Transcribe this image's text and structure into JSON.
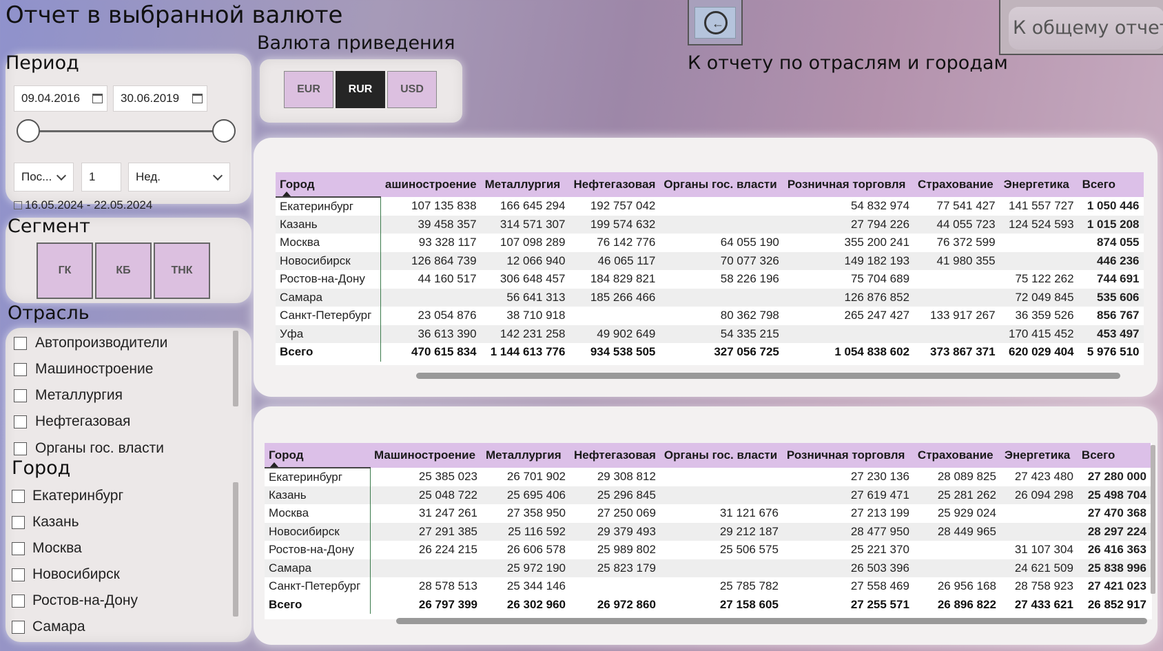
{
  "page": {
    "title": "Отчет в выбранной валюте"
  },
  "period": {
    "label": "Период",
    "start_date": "09.04.2016",
    "end_date": "30.06.2019",
    "relative_mode": "Пос...",
    "relative_count": "1",
    "relative_unit": "Нед.",
    "relative_range": "16.05.2024 - 22.05.2024"
  },
  "currency": {
    "label": "Валюта приведения",
    "options": [
      "EUR",
      "RUR",
      "USD"
    ],
    "selected": "RUR"
  },
  "segment": {
    "label": "Сегмент",
    "options": [
      "ГК",
      "КБ",
      "ТНК"
    ]
  },
  "industry_filter": {
    "label": "Отрасль",
    "items": [
      "Автопроизводители",
      "Машиностроение",
      "Металлургия",
      "Нефтегазовая",
      "Органы гос. власти"
    ]
  },
  "city_filter": {
    "label": "Город",
    "items": [
      "Екатеринбург",
      "Казань",
      "Москва",
      "Новосибирск",
      "Ростов-на-Дону",
      "Самара"
    ]
  },
  "nav": {
    "back_label": "К отчету по отраслям и городам",
    "main_report_label": "К общему отчету"
  },
  "table1": {
    "headers": [
      "Город",
      "ашиностроение",
      "Металлургия",
      "Нефтегазовая",
      "Органы гос. власти",
      "Розничная торговля",
      "Страхование",
      "Энергетика",
      "Всего"
    ],
    "rows": [
      [
        "Екатеринбург",
        "107 135 838",
        "166 645 294",
        "192 757 042",
        "",
        "54 832 974",
        "77 541 427",
        "141 557 727",
        "1 050 446"
      ],
      [
        "Казань",
        "39 458 357",
        "314 571 307",
        "199 574 632",
        "",
        "27 794 226",
        "44 055 723",
        "124 524 593",
        "1 015 208"
      ],
      [
        "Москва",
        "93 328 117",
        "107 098 289",
        "76 142 776",
        "64 055 190",
        "355 200 241",
        "76 372 599",
        "",
        "874 055"
      ],
      [
        "Новосибирск",
        "126 864 739",
        "12 066 940",
        "46 065 117",
        "70 077 326",
        "149 182 193",
        "41 980 355",
        "",
        "446 236"
      ],
      [
        "Ростов-на-Дону",
        "44 160 517",
        "306 648 457",
        "184 829 821",
        "58 226 196",
        "75 704 689",
        "",
        "75 122 262",
        "744 691"
      ],
      [
        "Самара",
        "",
        "56 641 313",
        "185 266 466",
        "",
        "126 876 852",
        "",
        "72 049 845",
        "535 606"
      ],
      [
        "Санкт-Петербург",
        "23 054 876",
        "38 710 918",
        "",
        "80 362 798",
        "265 247 427",
        "133 917 267",
        "36 359 526",
        "856 767"
      ],
      [
        "Уфа",
        "36 613 390",
        "142 231 258",
        "49 902 649",
        "54 335 215",
        "",
        "",
        "170 415 452",
        "453 497"
      ]
    ],
    "total": [
      "Всего",
      "470 615 834",
      "1 144 613 776",
      "934 538 505",
      "327 056 725",
      "1 054 838 602",
      "373 867 371",
      "620 029 404",
      "5 976 510"
    ]
  },
  "table2": {
    "headers": [
      "Город",
      "Машиностроение",
      "Металлургия",
      "Нефтегазовая",
      "Органы гос. власти",
      "Розничная торговля",
      "Страхование",
      "Энергетика",
      "Всего"
    ],
    "rows": [
      [
        "Екатеринбург",
        "25 385 023",
        "26 701 902",
        "29 308 812",
        "",
        "27 230 136",
        "28 089 825",
        "27 423 480",
        "27 280 000"
      ],
      [
        "Казань",
        "25 048 722",
        "25 695 406",
        "25 296 845",
        "",
        "27 619 471",
        "25 281 262",
        "26 094 298",
        "25 498 704"
      ],
      [
        "Москва",
        "31 247 261",
        "27 358 950",
        "27 250 069",
        "31 121 676",
        "27 213 199",
        "25 929 024",
        "",
        "27 470 368"
      ],
      [
        "Новосибирск",
        "27 291 385",
        "25 116 592",
        "29 379 493",
        "29 212 187",
        "28 477 950",
        "28 449 965",
        "",
        "28 297 224"
      ],
      [
        "Ростов-на-Дону",
        "26 224 215",
        "26 606 578",
        "25 989 802",
        "25 506 575",
        "25 221 370",
        "",
        "31 107 304",
        "26 416 363"
      ],
      [
        "Самара",
        "",
        "25 972 190",
        "25 823 179",
        "",
        "26 503 396",
        "",
        "24 621 509",
        "25 838 996"
      ],
      [
        "Санкт-Петербург",
        "28 578 513",
        "25 344 146",
        "",
        "25 785 782",
        "27 558 469",
        "26 956 168",
        "28 758 923",
        "27 421 023"
      ]
    ],
    "total": [
      "Всего",
      "26 797 399",
      "26 302 960",
      "26 972 860",
      "27 158 605",
      "27 255 571",
      "26 896 822",
      "27 433 621",
      "26 852 917"
    ]
  }
}
